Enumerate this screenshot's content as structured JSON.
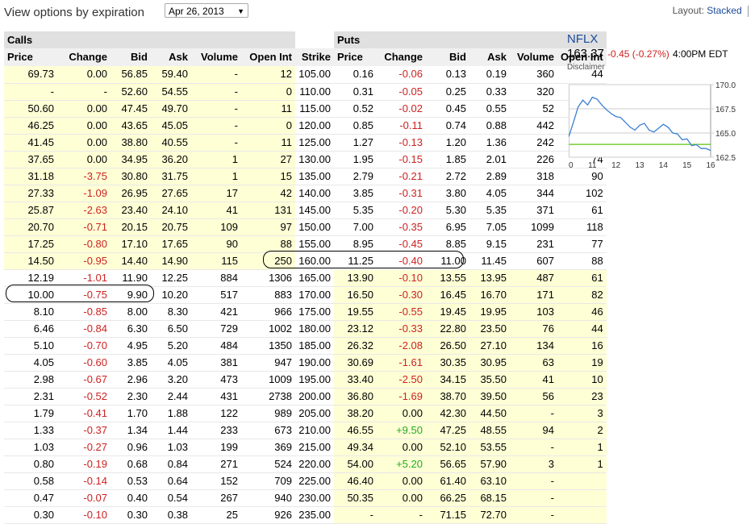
{
  "header": {
    "title": "View options by expiration",
    "expiration": "Apr 26, 2013",
    "layout_label": "Layout:",
    "layout_value": "Stacked"
  },
  "table": {
    "calls_label": "Calls",
    "puts_label": "Puts",
    "columns": [
      "Price",
      "Change",
      "Bid",
      "Ask",
      "Volume",
      "Open Int",
      "Strike",
      "Price",
      "Change",
      "Bid",
      "Ask",
      "Volume",
      "Open Int"
    ],
    "rows": [
      [
        "69.73",
        "0.00",
        "56.85",
        "59.40",
        "-",
        "12",
        "105.00",
        "0.16",
        "-0.06",
        "0.13",
        "0.19",
        "360",
        "44"
      ],
      [
        "-",
        "-",
        "52.60",
        "54.55",
        "-",
        "0",
        "110.00",
        "0.31",
        "-0.05",
        "0.25",
        "0.33",
        "320",
        "44"
      ],
      [
        "50.60",
        "0.00",
        "47.45",
        "49.70",
        "-",
        "11",
        "115.00",
        "0.52",
        "-0.02",
        "0.45",
        "0.55",
        "52",
        "18"
      ],
      [
        "46.25",
        "0.00",
        "43.65",
        "45.05",
        "-",
        "0",
        "120.00",
        "0.85",
        "-0.11",
        "0.74",
        "0.88",
        "442",
        "31"
      ],
      [
        "41.45",
        "0.00",
        "38.80",
        "40.55",
        "-",
        "11",
        "125.00",
        "1.27",
        "-0.13",
        "1.20",
        "1.36",
        "242",
        "33"
      ],
      [
        "37.65",
        "0.00",
        "34.95",
        "36.20",
        "1",
        "27",
        "130.00",
        "1.95",
        "-0.15",
        "1.85",
        "2.01",
        "226",
        "74"
      ],
      [
        "31.18",
        "-3.75",
        "30.80",
        "31.75",
        "1",
        "15",
        "135.00",
        "2.79",
        "-0.21",
        "2.72",
        "2.89",
        "318",
        "90"
      ],
      [
        "27.33",
        "-1.09",
        "26.95",
        "27.65",
        "17",
        "42",
        "140.00",
        "3.85",
        "-0.31",
        "3.80",
        "4.05",
        "344",
        "102"
      ],
      [
        "25.87",
        "-2.63",
        "23.40",
        "24.10",
        "41",
        "131",
        "145.00",
        "5.35",
        "-0.20",
        "5.30",
        "5.35",
        "371",
        "61"
      ],
      [
        "20.70",
        "-0.71",
        "20.15",
        "20.75",
        "109",
        "97",
        "150.00",
        "7.00",
        "-0.35",
        "6.95",
        "7.05",
        "1099",
        "118"
      ],
      [
        "17.25",
        "-0.80",
        "17.10",
        "17.65",
        "90",
        "88",
        "155.00",
        "8.95",
        "-0.45",
        "8.85",
        "9.15",
        "231",
        "77"
      ],
      [
        "14.50",
        "-0.95",
        "14.40",
        "14.90",
        "115",
        "250",
        "160.00",
        "11.25",
        "-0.40",
        "11.00",
        "11.45",
        "607",
        "88"
      ],
      [
        "12.19",
        "-1.01",
        "11.90",
        "12.25",
        "884",
        "1306",
        "165.00",
        "13.90",
        "-0.10",
        "13.55",
        "13.95",
        "487",
        "61"
      ],
      [
        "10.00",
        "-0.75",
        "9.90",
        "10.20",
        "517",
        "883",
        "170.00",
        "16.50",
        "-0.30",
        "16.45",
        "16.70",
        "171",
        "82"
      ],
      [
        "8.10",
        "-0.85",
        "8.00",
        "8.30",
        "421",
        "966",
        "175.00",
        "19.55",
        "-0.55",
        "19.45",
        "19.95",
        "103",
        "46"
      ],
      [
        "6.46",
        "-0.84",
        "6.30",
        "6.50",
        "729",
        "1002",
        "180.00",
        "23.12",
        "-0.33",
        "22.80",
        "23.50",
        "76",
        "44"
      ],
      [
        "5.10",
        "-0.70",
        "4.95",
        "5.20",
        "484",
        "1350",
        "185.00",
        "26.32",
        "-2.08",
        "26.50",
        "27.10",
        "134",
        "16"
      ],
      [
        "4.05",
        "-0.60",
        "3.85",
        "4.05",
        "381",
        "947",
        "190.00",
        "30.69",
        "-1.61",
        "30.35",
        "30.95",
        "63",
        "19"
      ],
      [
        "2.98",
        "-0.67",
        "2.96",
        "3.20",
        "473",
        "1009",
        "195.00",
        "33.40",
        "-2.50",
        "34.15",
        "35.50",
        "41",
        "10"
      ],
      [
        "2.31",
        "-0.52",
        "2.30",
        "2.44",
        "431",
        "2738",
        "200.00",
        "36.80",
        "-1.69",
        "38.70",
        "39.50",
        "56",
        "23"
      ],
      [
        "1.79",
        "-0.41",
        "1.70",
        "1.88",
        "122",
        "989",
        "205.00",
        "38.20",
        "0.00",
        "42.30",
        "44.50",
        "-",
        "3"
      ],
      [
        "1.33",
        "-0.37",
        "1.34",
        "1.44",
        "233",
        "673",
        "210.00",
        "46.55",
        "+9.50",
        "47.25",
        "48.55",
        "94",
        "2"
      ],
      [
        "1.03",
        "-0.27",
        "0.96",
        "1.03",
        "199",
        "369",
        "215.00",
        "49.34",
        "0.00",
        "52.10",
        "53.55",
        "-",
        "1"
      ],
      [
        "0.80",
        "-0.19",
        "0.68",
        "0.84",
        "271",
        "524",
        "220.00",
        "54.00",
        "+5.20",
        "56.65",
        "57.90",
        "3",
        "1"
      ],
      [
        "0.58",
        "-0.14",
        "0.53",
        "0.64",
        "152",
        "709",
        "225.00",
        "46.40",
        "0.00",
        "61.40",
        "63.10",
        "-",
        ""
      ],
      [
        "0.47",
        "-0.07",
        "0.40",
        "0.54",
        "267",
        "940",
        "230.00",
        "50.35",
        "0.00",
        "66.25",
        "68.15",
        "-",
        ""
      ],
      [
        "0.30",
        "-0.10",
        "0.30",
        "0.38",
        "25",
        "926",
        "235.00",
        "-",
        "-",
        "71.15",
        "72.70",
        "-",
        ""
      ]
    ]
  },
  "quote": {
    "symbol": "NFLX",
    "price": "163.37",
    "change": "-0.45 (-0.27%)",
    "time": "4:00PM EDT",
    "disclaimer": "Disclaimer"
  },
  "colors": {
    "itm": "#ffffd6",
    "negative": "#cc2222",
    "positive": "#22aa22",
    "link": "#1a4a9a",
    "line": "#3a7fd5",
    "prev_close": "#77cc33"
  },
  "chart_data": {
    "type": "line",
    "x": [
      10,
      10.2,
      10.4,
      10.6,
      10.8,
      11,
      11.2,
      11.4,
      11.6,
      11.8,
      12,
      12.2,
      12.4,
      12.6,
      12.8,
      13,
      13.2,
      13.4,
      13.6,
      13.8,
      14,
      14.2,
      14.4,
      14.6,
      14.8,
      15,
      15.2,
      15.4,
      15.6,
      15.8,
      16
    ],
    "series": [
      {
        "values": [
          164.6,
          166.1,
          167.7,
          168.4,
          167.9,
          168.7,
          168.5,
          167.9,
          167.4,
          167.0,
          166.7,
          166.6,
          166.1,
          165.6,
          165.3,
          165.8,
          166.0,
          165.3,
          165.1,
          165.5,
          165.9,
          165.6,
          165.0,
          164.9,
          164.3,
          164.4,
          163.7,
          163.8,
          163.4,
          163.4,
          163.2
        ]
      }
    ],
    "reference": 163.82,
    "xticks": [
      "10",
      "11",
      "12",
      "13",
      "14",
      "15",
      "16"
    ],
    "yticks": [
      "170.0",
      "167.5",
      "165.0",
      "162.5"
    ],
    "xlim": [
      10,
      16
    ],
    "ylim": [
      162.5,
      170
    ],
    "grid": true
  }
}
